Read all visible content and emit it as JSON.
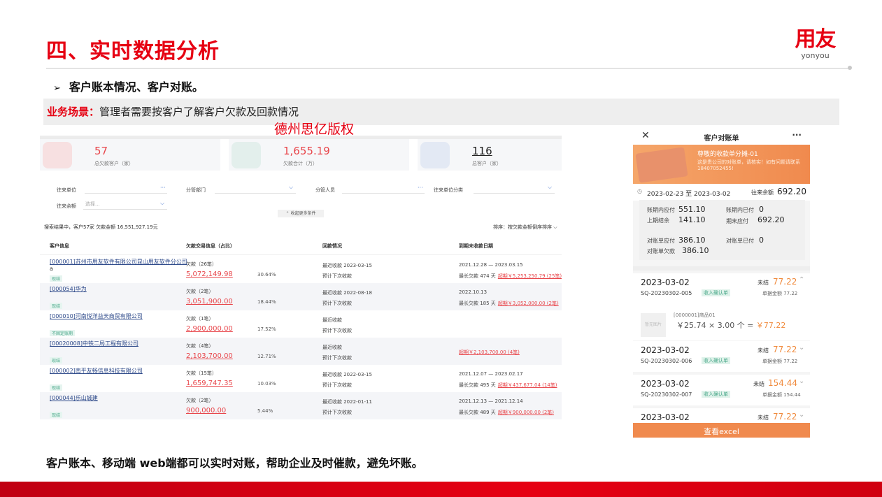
{
  "slide": {
    "title": "四、实时数据分析",
    "bullet_arrow": "➢",
    "bullet": "客户账本情况、客户对账。",
    "scenario_label": "业务场景：",
    "scenario_text": "管理者需要按客户了解客户欠款及回款情况",
    "watermark": "德州思亿版权",
    "conclusion": "客户账本、移动端 web端都可以实时对账，帮助企业及时催款，避免坏账。"
  },
  "logo": {
    "cn": "用友",
    "en": "yonyou"
  },
  "colors": {
    "brand_red": "#e60012",
    "accent_orange": "#f08a4e",
    "amount_red": "#e8464b",
    "tag_green": "#4aa88a"
  },
  "web": {
    "kpis": [
      {
        "value": "57",
        "caption": "总欠款客户（家）"
      },
      {
        "value": "1,655.19",
        "caption": "欠款合计（万）"
      },
      {
        "value": "116",
        "caption": "总客户（家）"
      }
    ],
    "filters": {
      "partner_unit": "往来单位",
      "dept": "分管部门",
      "person": "分管人员",
      "category": "往来单位分类",
      "balance": "往来余额",
      "balance_placeholder": "选择..."
    },
    "more_conditions": "收起更多条件",
    "summary": "搜索结果中，客户57家      欠款金额 16,551,927.19元",
    "sort": "排序：按欠款金额倒序排序",
    "headers": {
      "customer": "客户信息",
      "debt": "欠款交易信息（占比）",
      "receipt": "回款情况",
      "due": "到期未收款日期"
    },
    "rows": [
      {
        "name": "[000001]苏州市用友软件有限公司昆山用友软件分公司",
        "name2": "a",
        "tag": "现结",
        "debt_label": "欠款（26笔）",
        "amount": "5,072,149.98",
        "pct": "30.64%",
        "recent": "最近收款     2023-03-15",
        "next": "预计下次收款",
        "due": "2021.12.28 — 2023.03.15",
        "age": "最长欠款 474 天",
        "overdue": "超期￥5,253,250.79 (25笔)"
      },
      {
        "name": "[000054]华为",
        "name2": "",
        "tag": "现结",
        "debt_label": "欠款（2笔）",
        "amount": "3,051,900.00",
        "pct": "18.44%",
        "recent": "最近收款     2022-08-18",
        "next": "预计下次收款",
        "due": "2022.10.13",
        "age": "最长欠款 185 天",
        "overdue": "超期￥3,052,000.00 (2笔)"
      },
      {
        "name": "[000010]河南悦洋益天商贸有限公司",
        "name2": "",
        "tag": "不固定账期",
        "debt_label": "欠款（1笔）",
        "amount": "2,900,000.00",
        "pct": "17.52%",
        "recent": "最近收款",
        "next": "预计下次收款",
        "due": "",
        "age": "",
        "overdue": ""
      },
      {
        "name": "[00020008]中铁二局工程有限公司",
        "name2": "",
        "tag": "现结",
        "debt_label": "欠款（4笔）",
        "amount": "2,103,700.00",
        "pct": "12.71%",
        "recent": "最近收款",
        "next": "预计下次收款",
        "due": "",
        "age": "",
        "overdue": "超期￥2,103,700.00 (4笔)"
      },
      {
        "name": "[000002]南平友畅信息科技有限公司",
        "name2": "",
        "tag": "现结",
        "debt_label": "欠款（15笔）",
        "amount": "1,659,747.35",
        "pct": "10.03%",
        "recent": "最近收款     2022-03-15",
        "next": "预计下次收款",
        "due": "2021.12.07 — 2023.02.17",
        "age": "最长欠款 495 天",
        "overdue": "超期￥437,677.04 (14笔)"
      },
      {
        "name": "[000044]乐山城建",
        "name2": "",
        "tag": "现结",
        "debt_label": "欠款（2笔）",
        "amount": "900,000.00",
        "pct": "5.44%",
        "recent": "最近收款     2022-01-11",
        "next": "预计下次收款",
        "due": "2021.12.13 — 2021.12.14",
        "age": "最长欠款 489 天",
        "overdue": "超期￥900,000.00 (2笔)"
      }
    ]
  },
  "mobile": {
    "title": "客户对账单",
    "close": "✕",
    "menu": "···",
    "banner_title": "尊敬的收款单分摊-01",
    "banner_text": "这是贵公司的对账单，请核实！如有问题请联系18407052455!",
    "period": "2023-02-23 至 2023-03-02",
    "balance_label": "往来余额",
    "balance": "692.20",
    "stats": [
      {
        "label": "账期内应付",
        "value": "551.10"
      },
      {
        "label": "账期内已付",
        "value": "0"
      },
      {
        "label": "上期结余",
        "value": "141.10"
      },
      {
        "label": "期末应付",
        "value": "692.20"
      },
      {
        "label": "对账单应付",
        "value": "386.10"
      },
      {
        "label": "对账单已付",
        "value": "0"
      },
      {
        "label": "对账单欠款",
        "value": "386.10"
      }
    ],
    "items": [
      {
        "date": "2023-03-02",
        "status": "未结",
        "amount": "77.22",
        "no": "SQ-20230302-005",
        "tag": "收入确认单",
        "sum": "单据金额 77.22",
        "product": "[0000001]商品01",
        "calc": "￥25.74 × 3.00 个 = ",
        "result": "￥77.22"
      },
      {
        "date": "2023-03-02",
        "status": "未结",
        "amount": "77.22",
        "no": "SQ-20230302-006",
        "tag": "收入确认单",
        "sum": "单据金额 77.22"
      },
      {
        "date": "2023-03-02",
        "status": "未结",
        "amount": "154.44",
        "no": "SQ-20230302-007",
        "tag": "收入确认单",
        "sum": "单据金额 154.44"
      },
      {
        "date": "2023-03-02",
        "status": "未结",
        "amount": "77.22"
      }
    ],
    "thumb_text": "暂无图片",
    "excel_button": "查看excel"
  }
}
